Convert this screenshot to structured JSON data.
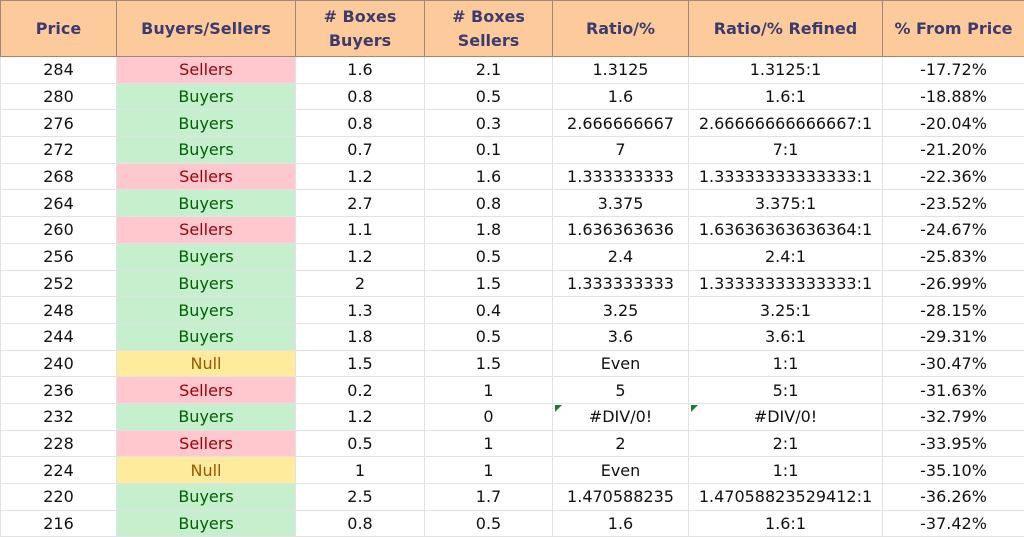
{
  "headers": [
    "Price",
    "Buyers/Sellers",
    "# Boxes Buyers",
    "# Boxes Sellers",
    "Ratio/%",
    "Ratio/% Refined",
    "% From Price"
  ],
  "colors": {
    "header_bg": "#fdcb9b",
    "sellers_bg": "#ffc7ce",
    "buyers_bg": "#c6efce",
    "null_bg": "#ffeb9c"
  },
  "rows": [
    [
      "284",
      "Sellers",
      "1.6",
      "2.1",
      "1.3125",
      "1.3125:1",
      "-17.72%"
    ],
    [
      "280",
      "Buyers",
      "0.8",
      "0.5",
      "1.6",
      "1.6:1",
      "-18.88%"
    ],
    [
      "276",
      "Buyers",
      "0.8",
      "0.3",
      "2.666666667",
      "2.66666666666667:1",
      "-20.04%"
    ],
    [
      "272",
      "Buyers",
      "0.7",
      "0.1",
      "7",
      "7:1",
      "-21.20%"
    ],
    [
      "268",
      "Sellers",
      "1.2",
      "1.6",
      "1.333333333",
      "1.33333333333333:1",
      "-22.36%"
    ],
    [
      "264",
      "Buyers",
      "2.7",
      "0.8",
      "3.375",
      "3.375:1",
      "-23.52%"
    ],
    [
      "260",
      "Sellers",
      "1.1",
      "1.8",
      "1.636363636",
      "1.63636363636364:1",
      "-24.67%"
    ],
    [
      "256",
      "Buyers",
      "1.2",
      "0.5",
      "2.4",
      "2.4:1",
      "-25.83%"
    ],
    [
      "252",
      "Buyers",
      "2",
      "1.5",
      "1.333333333",
      "1.33333333333333:1",
      "-26.99%"
    ],
    [
      "248",
      "Buyers",
      "1.3",
      "0.4",
      "3.25",
      "3.25:1",
      "-28.15%"
    ],
    [
      "244",
      "Buyers",
      "1.8",
      "0.5",
      "3.6",
      "3.6:1",
      "-29.31%"
    ],
    [
      "240",
      "Null",
      "1.5",
      "1.5",
      "Even",
      "1:1",
      "-30.47%"
    ],
    [
      "236",
      "Sellers",
      "0.2",
      "1",
      "5",
      "5:1",
      "-31.63%"
    ],
    [
      "232",
      "Buyers",
      "1.2",
      "0",
      "#DIV/0!",
      "#DIV/0!",
      "-32.79%"
    ],
    [
      "228",
      "Sellers",
      "0.5",
      "1",
      "2",
      "2:1",
      "-33.95%"
    ],
    [
      "224",
      "Null",
      "1",
      "1",
      "Even",
      "1:1",
      "-35.10%"
    ],
    [
      "220",
      "Buyers",
      "2.5",
      "1.7",
      "1.470588235",
      "1.47058823529412:1",
      "-36.26%"
    ],
    [
      "216",
      "Buyers",
      "0.8",
      "0.5",
      "1.6",
      "1.6:1",
      "-37.42%"
    ]
  ]
}
